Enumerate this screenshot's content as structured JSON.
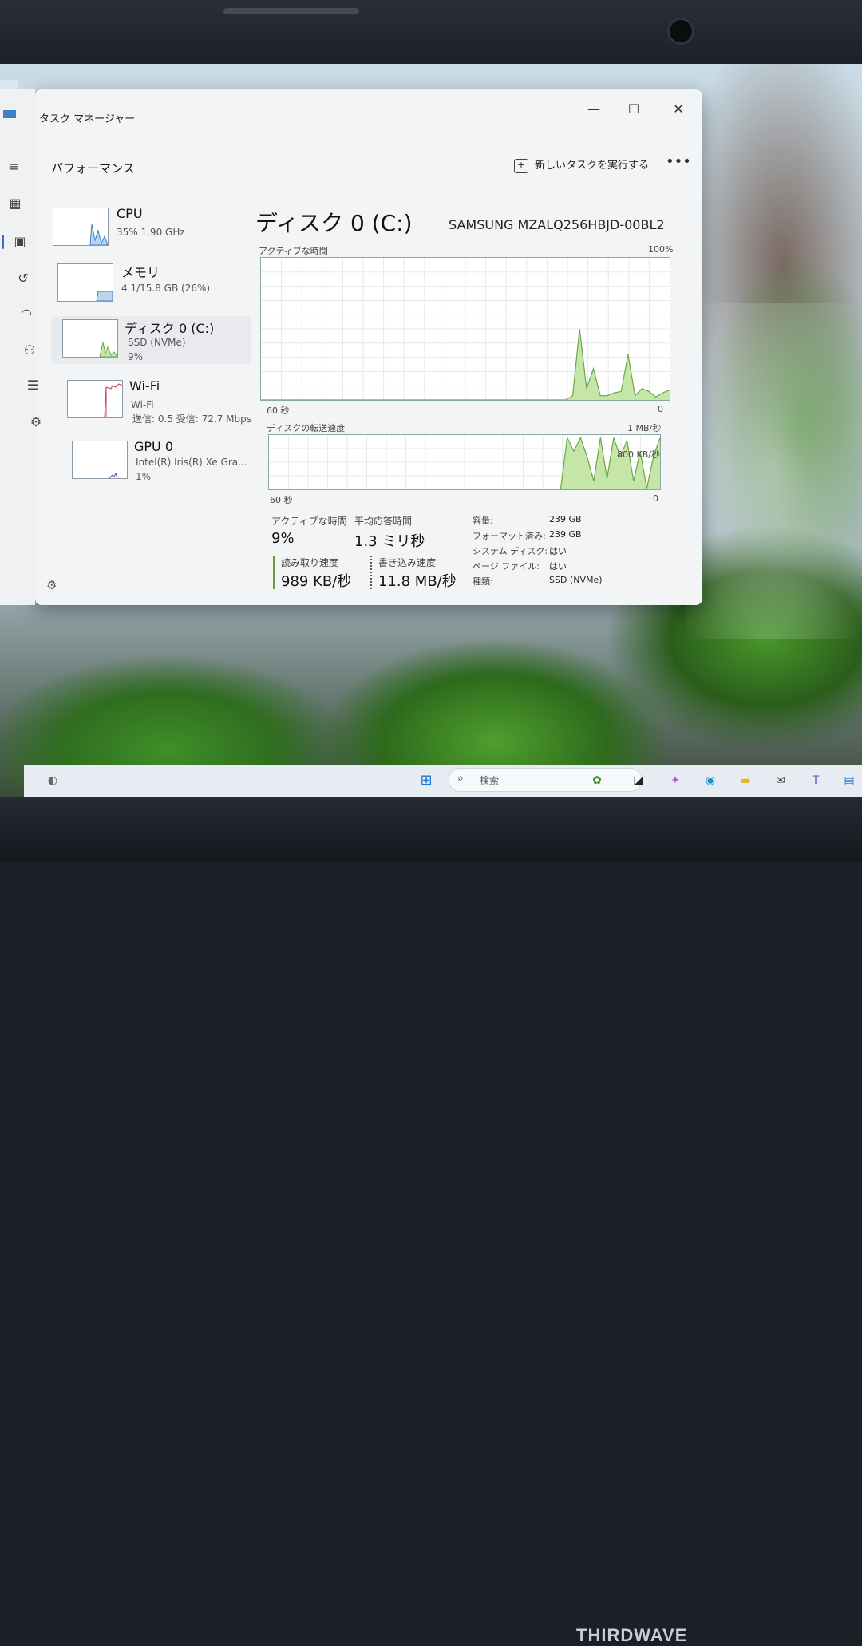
{
  "window": {
    "title": "タスク マネージャー"
  },
  "header": {
    "section": "パフォーマンス",
    "run_task": "新しいタスクを実行する",
    "more": "•••"
  },
  "devices": [
    {
      "name": "CPU",
      "sub1": "35%  1.90 GHz",
      "sub2": ""
    },
    {
      "name": "メモリ",
      "sub1": "4.1/15.8 GB (26%)",
      "sub2": ""
    },
    {
      "name": "ディスク 0 (C:)",
      "sub1": "SSD (NVMe)",
      "sub2": "9%"
    },
    {
      "name": "Wi-Fi",
      "sub1": "Wi-Fi",
      "sub2": "送信: 0.5  受信: 72.7 Mbps"
    },
    {
      "name": "GPU 0",
      "sub1": "Intel(R) Iris(R) Xe Gra...",
      "sub2": "1%"
    }
  ],
  "disk": {
    "title": "ディスク 0 (C:)",
    "model": "SAMSUNG MZALQ256HBJD-00BL2",
    "active_time_label": "アクティブな時間",
    "active_max": "100%",
    "time_left": "60 秒",
    "time_right": "0",
    "transfer_label": "ディスクの転送速度",
    "transfer_max": "1 MB/秒",
    "transfer_mid": "800 KB/秒",
    "time_left2": "60 秒",
    "time_right2": "0"
  },
  "stats": {
    "active_label": "アクティブな時間",
    "active_value": "9%",
    "avg_label": "平均応答時間",
    "avg_value": "1.3 ミリ秒",
    "read_label": "読み取り速度",
    "read_value": "989 KB/秒",
    "write_label": "書き込み速度",
    "write_value": "11.8 MB/秒"
  },
  "properties": [
    {
      "key": "容量:",
      "value": "239 GB"
    },
    {
      "key": "フォーマット済み:",
      "value": "239 GB"
    },
    {
      "key": "システム ディスク:",
      "value": "はい"
    },
    {
      "key": "ページ ファイル:",
      "value": "はい"
    },
    {
      "key": "種類:",
      "value": "SSD (NVMe)"
    }
  ],
  "taskbar": {
    "search_placeholder": "検索"
  },
  "brand": "THIRDWAVE",
  "chart_data": {
    "type": "area",
    "active_time_series": [
      0,
      0,
      0,
      0,
      0,
      0,
      0,
      0,
      0,
      0,
      0,
      0,
      0,
      0,
      0,
      0,
      0,
      0,
      0,
      0,
      0,
      0,
      0,
      0,
      0,
      0,
      0,
      0,
      0,
      0,
      0,
      0,
      0,
      0,
      0,
      0,
      0,
      0,
      0,
      0,
      0,
      0,
      0,
      0,
      0,
      3,
      50,
      8,
      22,
      3,
      3,
      5,
      6,
      32,
      3,
      8,
      6,
      2,
      5,
      7
    ],
    "transfer_series": [
      0,
      0,
      0,
      0,
      0,
      0,
      0,
      0,
      0,
      0,
      0,
      0,
      0,
      0,
      0,
      0,
      0,
      0,
      0,
      0,
      0,
      0,
      0,
      0,
      0,
      0,
      0,
      0,
      0,
      0,
      0,
      0,
      0,
      0,
      0,
      0,
      0,
      0,
      0,
      0,
      0,
      0,
      0,
      0,
      0,
      95,
      70,
      95,
      60,
      15,
      95,
      20,
      95,
      60,
      90,
      15,
      70,
      2,
      60,
      95
    ],
    "ylim_active": [
      0,
      100
    ]
  },
  "colors": {
    "graph_fill": "#c5e6a7",
    "graph_line": "#6aa64a",
    "accent": "#3b6bd6"
  }
}
